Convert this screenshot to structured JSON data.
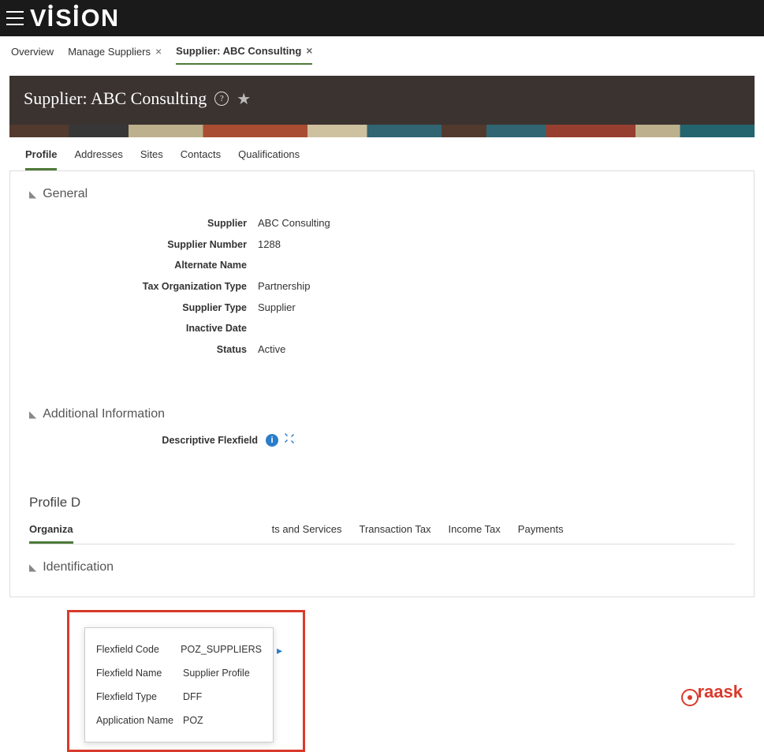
{
  "header": {
    "brand": "VISION"
  },
  "tabs": {
    "items": [
      {
        "label": "Overview",
        "closable": false
      },
      {
        "label": "Manage Suppliers",
        "closable": true
      },
      {
        "label": "Supplier: ABC Consulting",
        "closable": true,
        "active": true
      }
    ]
  },
  "page": {
    "title": "Supplier: ABC Consulting"
  },
  "subtabs": {
    "items": [
      {
        "label": "Profile",
        "active": true
      },
      {
        "label": "Addresses"
      },
      {
        "label": "Sites"
      },
      {
        "label": "Contacts"
      },
      {
        "label": "Qualifications"
      }
    ]
  },
  "sections": {
    "general": {
      "title": "General",
      "fields": {
        "supplier": {
          "label": "Supplier",
          "value": "ABC Consulting"
        },
        "supplier_number": {
          "label": "Supplier Number",
          "value": "1288"
        },
        "alternate_name": {
          "label": "Alternate Name",
          "value": ""
        },
        "tax_org_type": {
          "label": "Tax Organization Type",
          "value": "Partnership"
        },
        "supplier_type": {
          "label": "Supplier Type",
          "value": "Supplier"
        },
        "inactive_date": {
          "label": "Inactive Date",
          "value": ""
        },
        "status": {
          "label": "Status",
          "value": "Active"
        }
      }
    },
    "additional_info": {
      "title": "Additional Information",
      "flexfield_label": "Descriptive Flexfield"
    },
    "identification": {
      "title": "Identification"
    }
  },
  "popover": {
    "rows": {
      "code": {
        "label": "Flexfield Code",
        "value": "POZ_SUPPLIERS"
      },
      "name": {
        "label": "Flexfield Name",
        "value": "Supplier Profile"
      },
      "type": {
        "label": "Flexfield Type",
        "value": "DFF"
      },
      "app": {
        "label": "Application Name",
        "value": "POZ"
      }
    }
  },
  "profile_details": {
    "heading_partial": "Profile D",
    "tabs": [
      {
        "label": "Organiza",
        "active": true
      },
      {
        "label": "ts and Services"
      },
      {
        "label": "Transaction Tax"
      },
      {
        "label": "Income Tax"
      },
      {
        "label": "Payments"
      }
    ]
  },
  "watermark": "raask"
}
